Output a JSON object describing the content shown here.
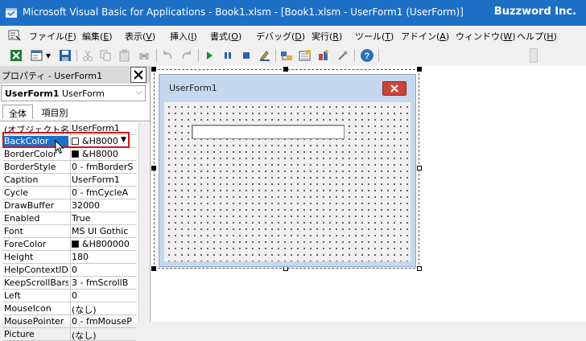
{
  "window": {
    "title": "Microsoft Visual Basic for Applications - Book1.xlsm - [Book1.xlsm - UserForm1 (UserForm)]",
    "brand": "Buzzword Inc."
  },
  "menu": [
    {
      "label": "ファイル(",
      "key": "F",
      "tail": ")"
    },
    {
      "label": "編集(",
      "key": "E",
      "tail": ")"
    },
    {
      "label": "表示(",
      "key": "V",
      "tail": ")"
    },
    {
      "label": "挿入(",
      "key": "I",
      "tail": ")"
    },
    {
      "label": "書式(",
      "key": "O",
      "tail": ")"
    },
    {
      "label": "デバッグ(",
      "key": "D",
      "tail": ")"
    },
    {
      "label": "実行(",
      "key": "R",
      "tail": ")"
    },
    {
      "label": "ツール(",
      "key": "T",
      "tail": ")"
    },
    {
      "label": "アドイン(",
      "key": "A",
      "tail": ")"
    },
    {
      "label": "ウィンドウ(",
      "key": "W",
      "tail": ")"
    },
    {
      "label": "ヘルプ(",
      "key": "H",
      "tail": ")"
    }
  ],
  "toolbar": {
    "icons": [
      "excel-icon",
      "insert-userform-icon",
      "save-icon",
      "cut-icon",
      "copy-icon",
      "paste-icon",
      "find-icon",
      "undo-icon",
      "redo-icon",
      "run-icon",
      "break-icon",
      "reset-icon",
      "design-mode-icon",
      "project-explorer-icon",
      "properties-window-icon",
      "object-browser-icon",
      "toolbox-icon",
      "help-icon"
    ]
  },
  "properties": {
    "panel_title": "プロパティ - UserForm1",
    "object_name": "UserForm1",
    "object_type": "UserForm",
    "tab_alpha": "全体",
    "tab_category": "項目別",
    "rows": [
      {
        "name": "(オブジェクト名)",
        "value": "UserForm1"
      },
      {
        "name": "BackColor",
        "value": "&H8000"
      },
      {
        "name": "BorderColor",
        "value": "&H8000"
      },
      {
        "name": "BorderStyle",
        "value": "0 - fmBorderS"
      },
      {
        "name": "Caption",
        "value": "UserForm1"
      },
      {
        "name": "Cycle",
        "value": "0 - fmCycleA"
      },
      {
        "name": "DrawBuffer",
        "value": "32000"
      },
      {
        "name": "Enabled",
        "value": "True"
      },
      {
        "name": "Font",
        "value": "MS UI Gothic"
      },
      {
        "name": "ForeColor",
        "value": "&H800000"
      },
      {
        "name": "Height",
        "value": "180"
      },
      {
        "name": "HelpContextID",
        "value": "0"
      },
      {
        "name": "KeepScrollBars",
        "value": "3 - fmScrollB"
      },
      {
        "name": "Left",
        "value": "0"
      },
      {
        "name": "MouseIcon",
        "value": "(なし)"
      },
      {
        "name": "MousePointer",
        "value": "0 - fmMouseP"
      },
      {
        "name": "Picture",
        "value": "(なし)"
      }
    ]
  },
  "form": {
    "caption": "UserForm1"
  },
  "colors": {
    "titlebar": "#1e6fc6",
    "selection": "#1e6fc6",
    "highlight_box": "#d01818",
    "form_close": "#c9473a"
  }
}
